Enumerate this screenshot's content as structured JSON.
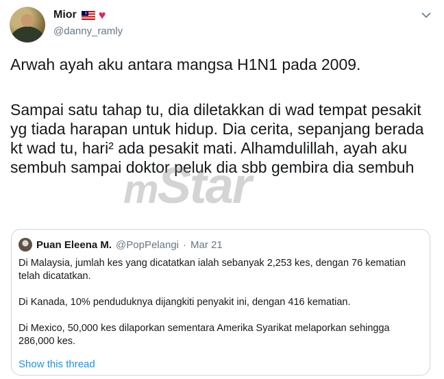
{
  "user": {
    "name": "Mior",
    "handle": "@danny_ramly",
    "emoji_flag": "malaysia-flag-icon",
    "emoji_heart": "heart-icon"
  },
  "tweet": {
    "line1": "Arwah ayah aku antara mangsa H1N1 pada 2009.",
    "para2": "Sampai satu tahap tu, dia diletakkan di wad tempat pesakit yg tiada harapan untuk hidup.  Dia cerita, sepanjang berada kt wad tu, hari² ada pesakit mati. Alhamdulillah, ayah aku sembuh sampai doktor peluk dia sbb gembira dia sembuh"
  },
  "watermark": {
    "prefix": "m",
    "text": "Star"
  },
  "quote": {
    "name": "Puan Eleena M.",
    "handle": "@PopPelangi",
    "separator": "·",
    "date": "Mar 21",
    "paragraphs": [
      "Di Malaysia, jumlah kes yang dicatatkan ialah sebanyak 2,253 kes, dengan 76 kematian telah dicatatkan.",
      "Di Kanada, 10% penduduknya dijangkiti penyakit ini, dengan 416 kematian.",
      "Di Mexico, 50,000 kes dilaporkan sementara Amerika Syarikat melaporkan sehingga 286,000 kes."
    ],
    "show_thread": "Show this thread"
  },
  "colors": {
    "link": "#1b95e0",
    "secondary": "#657786",
    "text": "#14171a",
    "heart": "#e0245e"
  }
}
